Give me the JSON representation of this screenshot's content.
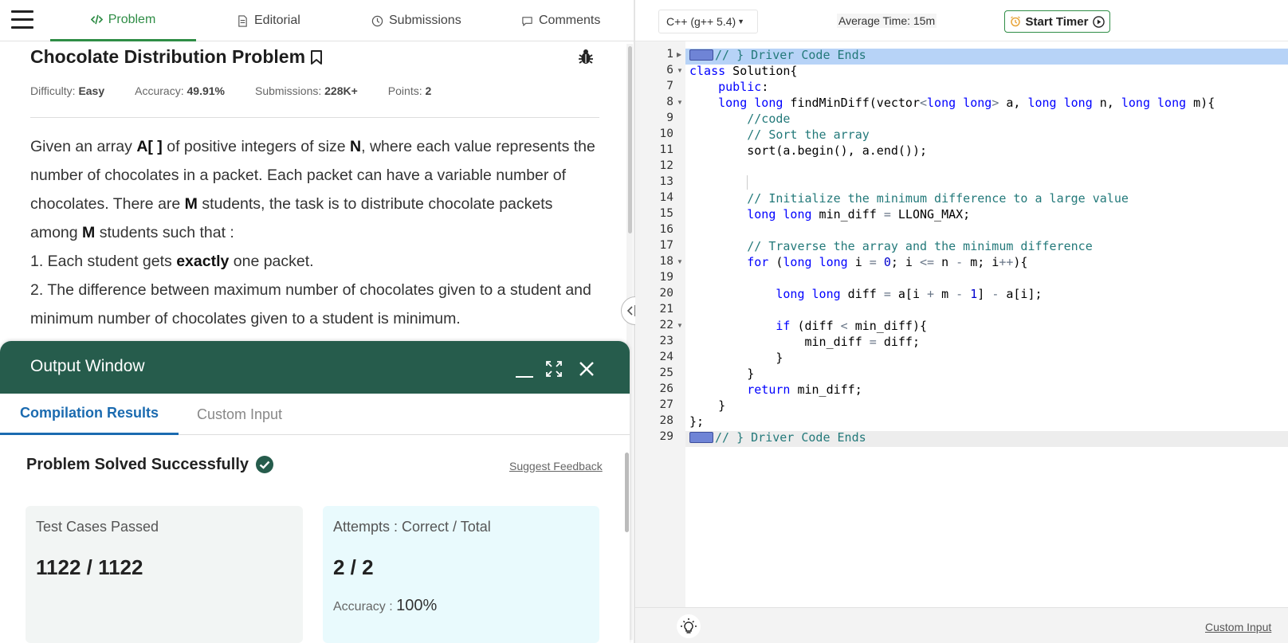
{
  "nav": {
    "tabs": [
      {
        "label": "Problem",
        "icon": "code-icon"
      },
      {
        "label": "Editorial",
        "icon": "document-icon"
      },
      {
        "label": "Submissions",
        "icon": "clock-icon"
      },
      {
        "label": "Comments",
        "icon": "comment-icon"
      }
    ]
  },
  "problem": {
    "title": "Chocolate Distribution Problem",
    "meta": [
      {
        "label": "Difficulty:",
        "value": "Easy"
      },
      {
        "label": "Accuracy:",
        "value": "49.91%"
      },
      {
        "label": "Submissions:",
        "value": "228K+"
      },
      {
        "label": "Points:",
        "value": "2"
      }
    ],
    "statement": {
      "p1_a": "Given an array ",
      "p1_b": "A[ ]",
      "p1_c": " of positive integers of size ",
      "p1_d": "N",
      "p1_e": ", where each value represents the number of chocolates in a packet. Each packet can have a variable number of chocolates. There are ",
      "p1_f": "M",
      "p1_g": " students, the task is to distribute chocolate packets among ",
      "p1_h": "M",
      "p1_i": " students such that :",
      "p2_a": "1. Each student gets ",
      "p2_b": "exactly",
      "p2_c": " one packet.",
      "p3": "2. The difference between maximum number of chocolates given to a student and minimum number of chocolates given to a student is minimum."
    }
  },
  "output": {
    "title": "Output Window",
    "tabs": [
      "Compilation Results",
      "Custom Input"
    ],
    "status": "Problem Solved Successfully",
    "feedback_link": "Suggest Feedback",
    "tests_label": "Test Cases Passed",
    "tests_value": "1122 / 1122",
    "attempts_label": "Attempts : Correct / Total",
    "attempts_value": "2 / 2",
    "accuracy_label": "Accuracy :",
    "accuracy_value": "100%"
  },
  "editor": {
    "language": "C++ (g++ 5.4)",
    "avg_time": "Average Time: 15m",
    "timer_label": "Start Timer",
    "line_numbers": [
      "1",
      "6",
      "7",
      "8",
      "9",
      "10",
      "11",
      "12",
      "13",
      "14",
      "15",
      "16",
      "17",
      "18",
      "19",
      "20",
      "21",
      "22",
      "23",
      "24",
      "25",
      "26",
      "27",
      "28",
      "29"
    ],
    "custom_input": "Custom Input"
  },
  "colors": {
    "brand_green": "#2f8d46",
    "output_header": "#265c4c",
    "active_blue": "#1b6bb0"
  }
}
